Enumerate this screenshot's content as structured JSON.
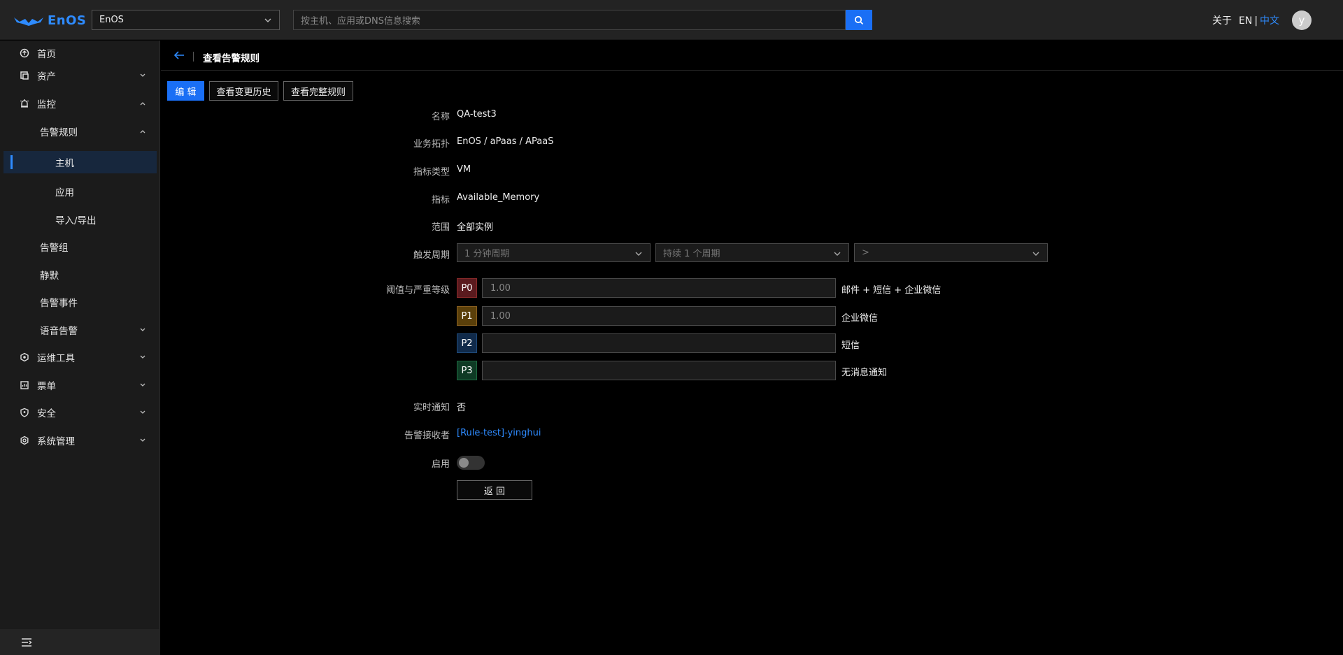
{
  "header": {
    "logo_text": "EnOS",
    "org_select": "EnOS",
    "search_placeholder": "按主机、应用或DNS信息搜索",
    "about": "关于",
    "lang_en": "EN",
    "lang_sep": "|",
    "lang_zh": "中文",
    "avatar_initial": "y"
  },
  "sidebar": {
    "items": [
      {
        "label": "首页"
      },
      {
        "label": "资产"
      },
      {
        "label": "监控"
      },
      {
        "label": "告警规则"
      },
      {
        "label": "主机"
      },
      {
        "label": "应用"
      },
      {
        "label": "导入/导出"
      },
      {
        "label": "告警组"
      },
      {
        "label": "静默"
      },
      {
        "label": "告警事件"
      },
      {
        "label": "语音告警"
      },
      {
        "label": "运维工具"
      },
      {
        "label": "票单"
      },
      {
        "label": "安全"
      },
      {
        "label": "系统管理"
      }
    ]
  },
  "page": {
    "title": "查看告警规则",
    "buttons": {
      "edit": "编 辑",
      "history": "查看变更历史",
      "full_rule": "查看完整规则",
      "back": "返 回"
    }
  },
  "form": {
    "name_label": "名称",
    "name_value": "QA-test3",
    "topology_label": "业务拓扑",
    "topology_value": "EnOS / aPaas / APaaS",
    "metric_type_label": "指标类型",
    "metric_type_value": "VM",
    "metric_label": "指标",
    "metric_value": "Available_Memory",
    "scope_label": "范围",
    "scope_value": "全部实例",
    "trigger_label": "触发周期",
    "trigger_period": "1 分钟周期",
    "trigger_duration": "持续 1 个周期",
    "trigger_operator": ">",
    "threshold_label": "阈值与严重等级",
    "levels": [
      {
        "tag": "P0",
        "value": "1.00",
        "channel": "邮件 + 短信 + 企业微信",
        "color": "#5a1a1e"
      },
      {
        "tag": "P1",
        "value": "1.00",
        "channel": "企业微信",
        "color": "#5a3f0a"
      },
      {
        "tag": "P2",
        "value": "",
        "channel": "短信",
        "color": "#102a4a"
      },
      {
        "tag": "P3",
        "value": "",
        "channel": "无消息通知",
        "color": "#0e3a24"
      }
    ],
    "realtime_label": "实时通知",
    "realtime_value": "否",
    "receiver_label": "告警接收者",
    "receiver_value": "[Rule-test]-yinghui",
    "enable_label": "启用",
    "enabled": false
  },
  "colors": {
    "accent": "#2e8bff",
    "primary_button": "#1a6ff5",
    "active_nav_bg": "#17273d"
  }
}
